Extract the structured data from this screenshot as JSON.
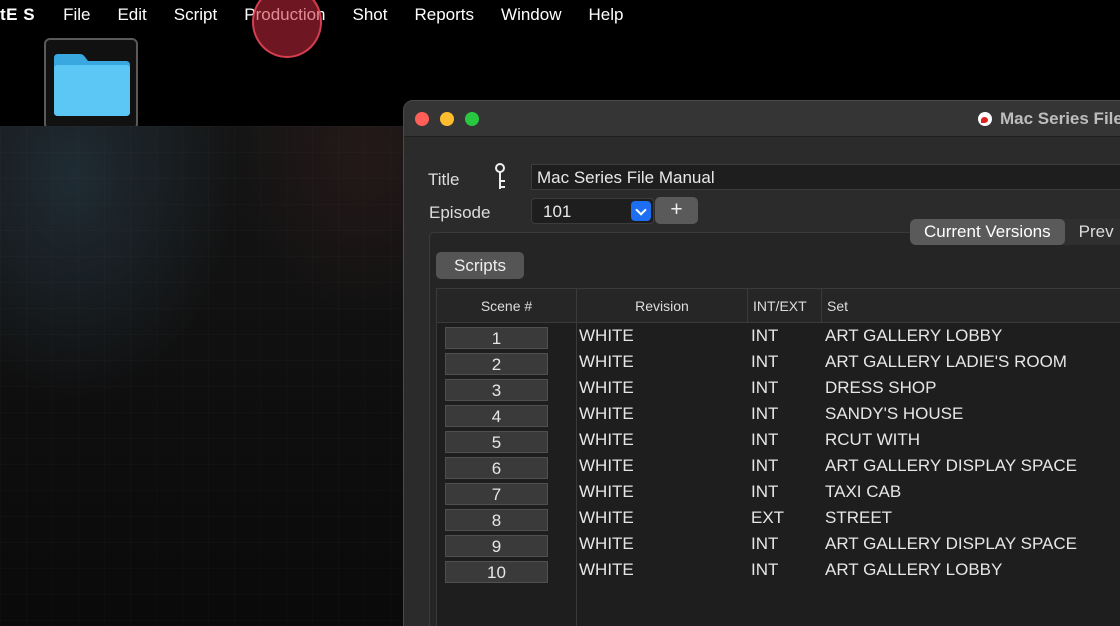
{
  "menubar": {
    "app_name": "tE S",
    "items": [
      "File",
      "Edit",
      "Script",
      "Production",
      "Shot",
      "Reports",
      "Window",
      "Help"
    ]
  },
  "window": {
    "title": "Mac Series File"
  },
  "form": {
    "title_label": "Title",
    "title_value": "Mac Series File Manual",
    "episode_label": "Episode",
    "episode_value": "101",
    "add_label": "+"
  },
  "tabs": {
    "current": "Current Versions",
    "previous": "Prev"
  },
  "scripts_button": "Scripts",
  "table": {
    "headers": [
      "Scene #",
      "Revision",
      "INT/EXT",
      "Set"
    ],
    "rows": [
      {
        "scene": "1",
        "revision": "WHITE",
        "int_ext": "INT",
        "set": "ART GALLERY LOBBY"
      },
      {
        "scene": "2",
        "revision": "WHITE",
        "int_ext": "INT",
        "set": "ART GALLERY LADIE'S ROOM"
      },
      {
        "scene": "3",
        "revision": "WHITE",
        "int_ext": "INT",
        "set": "DRESS SHOP"
      },
      {
        "scene": "4",
        "revision": "WHITE",
        "int_ext": "INT",
        "set": "SANDY'S HOUSE"
      },
      {
        "scene": "5",
        "revision": "WHITE",
        "int_ext": "INT",
        "set": "RCUT WITH"
      },
      {
        "scene": "6",
        "revision": "WHITE",
        "int_ext": "INT",
        "set": "ART GALLERY DISPLAY SPACE"
      },
      {
        "scene": "7",
        "revision": "WHITE",
        "int_ext": "INT",
        "set": "TAXI CAB"
      },
      {
        "scene": "8",
        "revision": "WHITE",
        "int_ext": "EXT",
        "set": "STREET"
      },
      {
        "scene": "9",
        "revision": "WHITE",
        "int_ext": "INT",
        "set": "ART GALLERY DISPLAY SPACE"
      },
      {
        "scene": "10",
        "revision": "WHITE",
        "int_ext": "INT",
        "set": "ART GALLERY LOBBY"
      }
    ]
  },
  "colors": {
    "close": "#ff5f57",
    "minimize": "#febc2e",
    "maximize": "#28c840",
    "accent": "#1d6ef2",
    "folder": "#4fc3f7"
  }
}
